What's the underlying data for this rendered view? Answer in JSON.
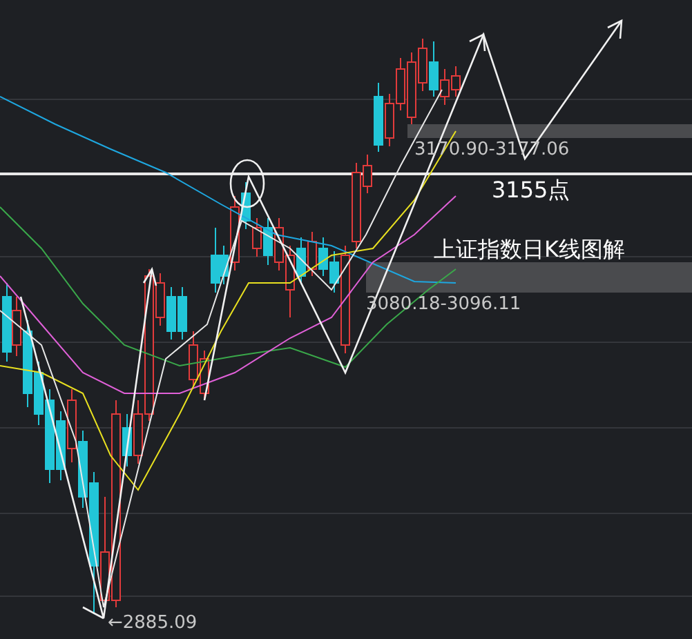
{
  "chart": {
    "title": "上证指数日K线图解",
    "labels": [
      {
        "kind": "range",
        "text": "3170.90-3177.06"
      },
      {
        "kind": "level",
        "text": "3155点"
      },
      {
        "kind": "range",
        "text": "3080.18-3096.11"
      },
      {
        "kind": "low",
        "text": "←2885.09"
      }
    ]
  }
}
